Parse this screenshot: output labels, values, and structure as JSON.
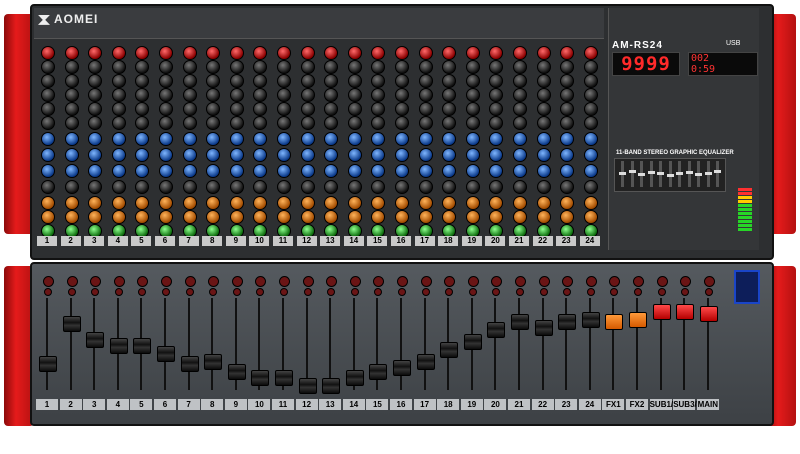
{
  "brand": "AOMEI",
  "model": "AM-RS24",
  "display": {
    "main_value": "9999",
    "sub_lines": [
      "002",
      "0:59"
    ]
  },
  "usb_label": "USB",
  "eq_title": "11-BAND STEREO GRAPHIC EQUALIZER",
  "channels": [
    "1",
    "2",
    "3",
    "4",
    "5",
    "6",
    "7",
    "8",
    "9",
    "10",
    "11",
    "12",
    "13",
    "14",
    "15",
    "16",
    "17",
    "18",
    "19",
    "20",
    "21",
    "22",
    "23",
    "24"
  ],
  "fader_labels": [
    "1",
    "2",
    "3",
    "4",
    "5",
    "6",
    "7",
    "8",
    "9",
    "10",
    "11",
    "12",
    "13",
    "14",
    "15",
    "16",
    "17",
    "18",
    "19",
    "20",
    "21",
    "22",
    "23",
    "24",
    "FX1",
    "FX2",
    "SUB1/2",
    "SUB3/4",
    "MAIN"
  ],
  "fader_levels": [
    0.28,
    0.78,
    0.58,
    0.5,
    0.5,
    0.4,
    0.28,
    0.3,
    0.18,
    0.1,
    0.1,
    0.0,
    0.0,
    0.1,
    0.18,
    0.22,
    0.3,
    0.45,
    0.55,
    0.7,
    0.8,
    0.72,
    0.8,
    0.82,
    0.8,
    0.82,
    0.92,
    0.92,
    0.9
  ],
  "fader_colors": {
    "default": "#111111",
    "fx": "#e86a10",
    "master": "#e01515"
  },
  "accent": "#e51b1b"
}
